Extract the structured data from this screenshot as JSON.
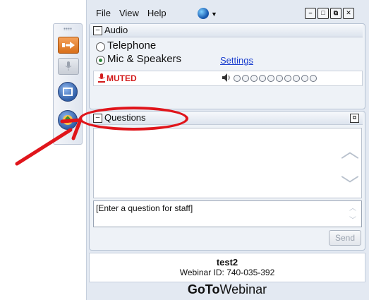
{
  "menu": {
    "file": "File",
    "view": "View",
    "help": "Help"
  },
  "window_buttons": {
    "minimize": "–",
    "restore": "□",
    "popout": "⧉",
    "close": "✕"
  },
  "audio": {
    "title": "Audio",
    "collapse_symbol": "–",
    "option_telephone": "Telephone",
    "option_mic": "Mic & Speakers",
    "settings_link": "Settings",
    "selected": "Mic & Speakers",
    "muted_label": "MUTED",
    "volume_level_boxes": 10
  },
  "questions": {
    "title": "Questions",
    "collapse_symbol": "–",
    "input_placeholder": "[Enter a question for staff]",
    "send_label": "Send"
  },
  "webinar": {
    "name": "test2",
    "id_line": "Webinar ID: 740-035-392"
  },
  "brand": {
    "goto": "GoTo",
    "webinar": "Webinar"
  },
  "icons": {
    "toolbar": [
      "arrow-right-icon",
      "microphone-icon",
      "screen-icon",
      "raise-hand-icon"
    ],
    "globe": "globe-icon"
  },
  "colors": {
    "muted_red": "#d31b1b",
    "annotation_red": "#e0151b",
    "link_blue": "#1b3fcf"
  }
}
